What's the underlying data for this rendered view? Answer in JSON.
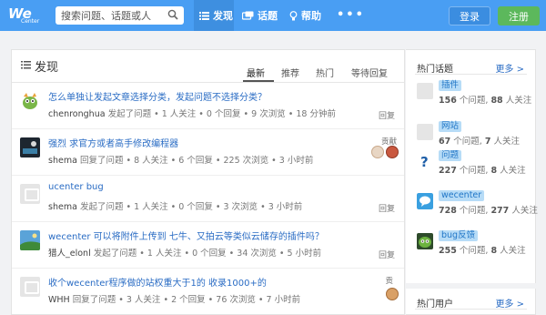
{
  "header": {
    "logo_text": "We",
    "logo_sub": "Center",
    "search_placeholder": "搜索问题、话题或人",
    "nav": [
      {
        "label": "发现",
        "icon": "list-icon"
      },
      {
        "label": "话题",
        "icon": "topic-icon"
      },
      {
        "label": "帮助",
        "icon": "bulb-icon"
      }
    ],
    "more": "•••",
    "login": "登录",
    "register": "注册"
  },
  "main": {
    "title": "发现",
    "tabs": [
      "最新",
      "推荐",
      "热门",
      "等待回复"
    ],
    "questions": [
      {
        "title": "怎么单独让发起文章选择分类，发起问题不选择分类？",
        "user": "chenronghua",
        "meta": "发起了问题 • 1 人关注 • 0 个回复 • 9 次浏览 • 18 分钟前",
        "action": "回复",
        "avatar": "monster-avatar"
      },
      {
        "title": "强烈 求官方或者高手修改编程器",
        "user": "shema",
        "meta": "回复了问题 • 8 人关注 • 6 个回复 • 225 次浏览 • 3 小时前",
        "action": "",
        "contrib": "贡献",
        "avatar": "dark-avatar"
      },
      {
        "title": "ucenter bug",
        "user": "shema",
        "meta": "发起了问题 • 1 人关注 • 0 个回复 • 3 次浏览 • 3 小时前",
        "action": "回复",
        "avatar": "default-avatar"
      },
      {
        "title": "wecenter 可以将附件上传到 七牛、又拍云等类似云储存的插件吗？",
        "user": "猎人_elonl",
        "meta": "发起了问题 • 1 人关注 • 0 个回复 • 34 次浏览 • 5 小时前",
        "action": "回复",
        "avatar": "landscape-avatar"
      },
      {
        "title": "收个wecenter程序做的站权重大于1的 收录1000+的",
        "user": "WHH",
        "meta": "回复了问题 • 3 人关注 • 2 个回复 • 76 次浏览 • 7 小时前",
        "action": "",
        "contrib": "贡",
        "avatar": "default-avatar"
      }
    ]
  },
  "sidebar": {
    "topics_title": "热门话题",
    "more": "更多 >",
    "topics": [
      {
        "name": "插件",
        "questions": "156",
        "q_label": "个问题,",
        "followers": "88",
        "f_label": "人关注"
      },
      {
        "name": "网站",
        "questions": "67",
        "q_label": "个问题,",
        "followers": "7",
        "f_label": "人关注"
      },
      {
        "name": "问题",
        "questions": "227",
        "q_label": "个问题,",
        "followers": "8",
        "f_label": "人关注"
      },
      {
        "name": "wecenter",
        "questions": "728",
        "q_label": "个问题,",
        "followers": "277",
        "f_label": "人关注"
      },
      {
        "name": "bug反馈",
        "questions": "255",
        "q_label": "个问题,",
        "followers": "8",
        "f_label": "人关注"
      }
    ],
    "users_title": "热门用户",
    "users_more": "更多 >"
  },
  "colors": {
    "header": "#499ef3",
    "link": "#2a6cc4",
    "register": "#5cb85c",
    "tag_bg": "#b7dcf7"
  }
}
